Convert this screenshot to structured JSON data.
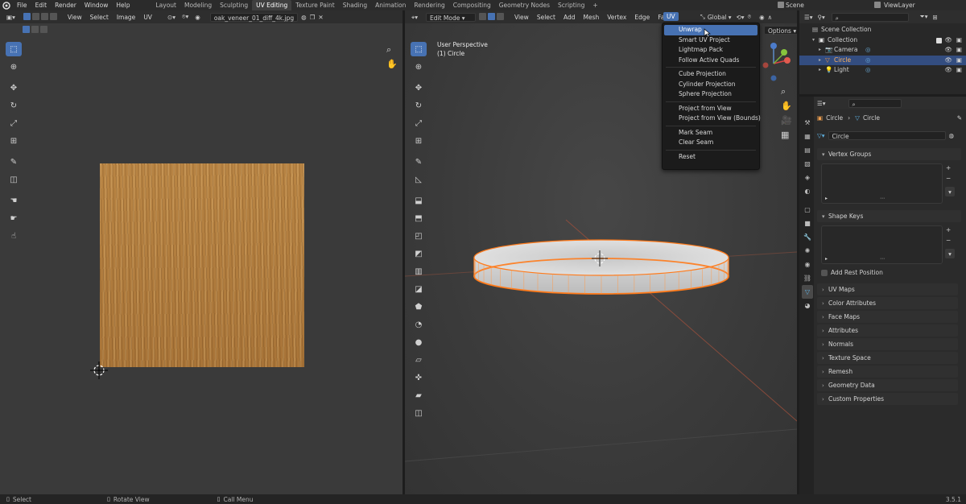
{
  "topbar": {
    "menus": [
      "File",
      "Edit",
      "Render",
      "Window",
      "Help"
    ],
    "workspaces": [
      "Layout",
      "Modeling",
      "Sculpting",
      "UV Editing",
      "Texture Paint",
      "Shading",
      "Animation",
      "Rendering",
      "Compositing",
      "Geometry Nodes",
      "Scripting"
    ],
    "active_workspace": "UV Editing",
    "add_tab": "+",
    "scene": "Scene",
    "view_layer": "ViewLayer"
  },
  "uv_editor": {
    "menus": [
      "View",
      "Select",
      "Image",
      "UV"
    ],
    "image_name": "oak_veneer_01_diff_4k.jpg",
    "texture_color": "#b98544"
  },
  "viewport": {
    "mode": "Edit Mode",
    "menus": [
      "View",
      "Select",
      "Add",
      "Mesh",
      "Vertex",
      "Edge",
      "Face",
      "UV"
    ],
    "active_menu": "UV",
    "transform_orientation": "Global",
    "options_label": "Options",
    "perspective": "User Perspective",
    "object": "(1) Circle",
    "selection_color": "#ff7a1a"
  },
  "uv_menu": {
    "groups": [
      [
        "Unwrap",
        "Smart UV Project",
        "Lightmap Pack",
        "Follow Active Quads"
      ],
      [
        "Cube Projection",
        "Cylinder Projection",
        "Sphere Projection"
      ],
      [
        "Project from View",
        "Project from View (Bounds)"
      ],
      [
        "Mark Seam",
        "Clear Seam"
      ],
      [
        "Reset"
      ]
    ],
    "highlighted": "Unwrap"
  },
  "outliner": {
    "rows": [
      {
        "label": "Scene Collection",
        "indent": 0
      },
      {
        "label": "Collection",
        "indent": 1
      },
      {
        "label": "Camera",
        "indent": 2
      },
      {
        "label": "Circle",
        "indent": 2,
        "selected": true
      },
      {
        "label": "Light",
        "indent": 2
      }
    ]
  },
  "properties": {
    "breadcrumb_object": "Circle",
    "breadcrumb_data": "Circle",
    "data_name": "Circle",
    "sections_top": [
      "Vertex Groups",
      "Shape Keys"
    ],
    "add_rest_position": "Add Rest Position",
    "sections": [
      "UV Maps",
      "Color Attributes",
      "Face Maps",
      "Attributes",
      "Normals",
      "Texture Space",
      "Remesh",
      "Geometry Data",
      "Custom Properties"
    ]
  },
  "statusbar": {
    "select": "Select",
    "rotate": "Rotate View",
    "call_menu": "Call Menu",
    "version": "3.5.1"
  }
}
